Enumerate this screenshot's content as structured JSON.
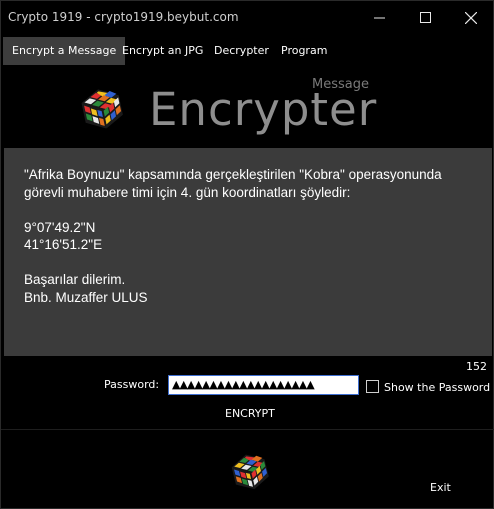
{
  "window": {
    "title": "Crypto 1919 - crypto1919.beybut.com"
  },
  "menu": {
    "items": [
      {
        "label": "Encrypt a Message",
        "active": true
      },
      {
        "label": "Encrypt an JPG",
        "active": false
      },
      {
        "label": "Decrypter",
        "active": false
      },
      {
        "label": "Program",
        "active": false
      }
    ]
  },
  "header": {
    "logo_icon": "rubiks-cube-icon",
    "title": "Encrypter",
    "subtitle": "Message"
  },
  "message": {
    "paragraphs": [
      "\"Afrika Boynuzu\" kapsamında gerçekleştirilen \"Kobra\" operasyonunda görevli muhabere timi için 4. gün koordinatları şöyledir:",
      "9°07'49.2\"N\n41°16'51.2\"E",
      "Başarılar dilerim.\nBnb. Muzaffer ULUS"
    ]
  },
  "char_count": "152",
  "password": {
    "label": "Password:",
    "value": "▲▲▲▲▲▲▲▲▲▲▲▲▲▲▲▲▲▲▲",
    "show_label": "Show the Password",
    "show_checked": false
  },
  "encrypt_label": "ENCRYPT",
  "footer": {
    "logo_icon": "rubiks-cube-icon",
    "exit_label": "Exit"
  },
  "colors": {
    "background": "#000000",
    "panel": "#3b3b3b",
    "active_tab": "#3d3d3d",
    "focus_border": "#3f6fd1",
    "logo_text": "#8e8e8e"
  }
}
